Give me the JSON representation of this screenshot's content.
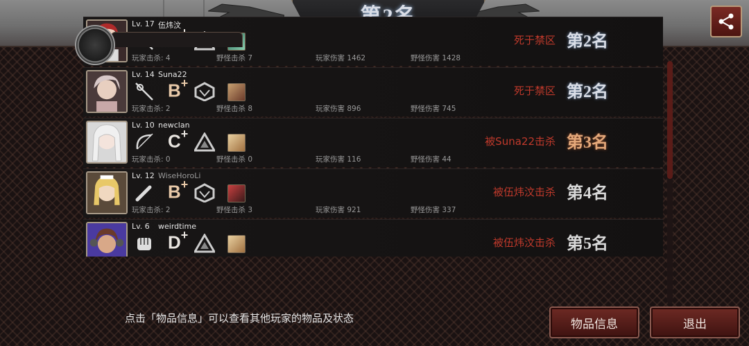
{
  "header": {
    "title": "第2名"
  },
  "players": [
    {
      "level": "Lv. 17",
      "name": "伍炜汶",
      "weapon_icon": "rapier-icon",
      "grade": "A",
      "grade_plus": "+",
      "gear_icon": "triangle-gear-icon",
      "item_icon": "leaf-item-icon",
      "kills_label": "玩家击杀: 4",
      "monster_kills_label": "野怪击杀 7",
      "player_damage_label": "玩家伤害 1462",
      "monster_damage_label": "野怪伤害 1428",
      "fate": "死于禁区",
      "rank": "第2名"
    },
    {
      "level": "Lv. 14",
      "name": "Suna22",
      "weapon_icon": "rapier-icon",
      "grade": "B",
      "grade_plus": "+",
      "gear_icon": "hex-gear-icon",
      "item_icon": "figure-item-icon",
      "kills_label": "玩家击杀: 2",
      "monster_kills_label": "野怪击杀 8",
      "player_damage_label": "玩家伤害 896",
      "monster_damage_label": "野怪伤害 745",
      "fate": "死于禁区",
      "rank": "第2名"
    },
    {
      "level": "Lv. 10",
      "name": "newclan",
      "weapon_icon": "bow-icon",
      "grade": "C",
      "grade_plus": "+",
      "gear_icon": "triangle-gear-icon",
      "item_icon": "scroll-item-icon",
      "kills_label": "玩家击杀: 0",
      "monster_kills_label": "野怪击杀 0",
      "player_damage_label": "玩家伤害 116",
      "monster_damage_label": "野怪伤害 44",
      "fate": "被Suna22击杀",
      "rank": "第3名"
    },
    {
      "level": "Lv. 12",
      "name": "WiseHoroLi",
      "weapon_icon": "bat-icon",
      "grade": "B",
      "grade_plus": "+",
      "gear_icon": "hex-gear-icon",
      "item_icon": "mask-item-icon",
      "kills_label": "玩家击杀: 2",
      "monster_kills_label": "野怪击杀 3",
      "player_damage_label": "玩家伤害 921",
      "monster_damage_label": "野怪伤害 337",
      "fate": "被伍炜汶击杀",
      "rank": "第4名"
    },
    {
      "level": "Lv. 6",
      "name": "weirdtime",
      "weapon_icon": "fist-icon",
      "grade": "D",
      "grade_plus": "+",
      "gear_icon": "triangle-gear-icon",
      "item_icon": "scroll-item-icon",
      "kills_label": "",
      "monster_kills_label": "",
      "player_damage_label": "",
      "monster_damage_label": "",
      "fate": "被伍炜汶击杀",
      "rank": "第5名"
    }
  ],
  "footer": {
    "hint": "点击「物品信息」可以查看其他玩家的物品及状态",
    "items_button": "物品信息",
    "exit_button": "退出"
  },
  "icons": {
    "share": "share-icon",
    "emblem": "clan-emblem-icon",
    "wolf": "wolf-watermark-icon"
  },
  "colors": {
    "fate_red": "#c0392b",
    "button_red": "#6e2a24",
    "panel_bg": "#1a1212"
  }
}
